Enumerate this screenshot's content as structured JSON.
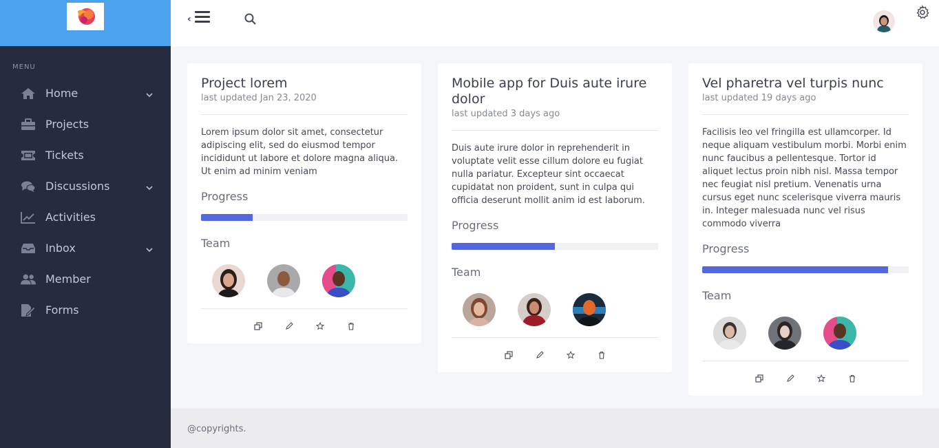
{
  "sidebar": {
    "menu_heading": "MENU",
    "items": [
      {
        "label": "Home",
        "icon": "home-icon",
        "has_submenu": true
      },
      {
        "label": "Projects",
        "icon": "briefcase-icon",
        "has_submenu": false
      },
      {
        "label": "Tickets",
        "icon": "ticket-icon",
        "has_submenu": false
      },
      {
        "label": "Discussions",
        "icon": "comments-icon",
        "has_submenu": true
      },
      {
        "label": "Activities",
        "icon": "chart-line-icon",
        "has_submenu": false
      },
      {
        "label": "Inbox",
        "icon": "inbox-icon",
        "has_submenu": true
      },
      {
        "label": "Member",
        "icon": "users-icon",
        "has_submenu": false
      },
      {
        "label": "Forms",
        "icon": "form-edit-icon",
        "has_submenu": false
      }
    ]
  },
  "header": {
    "toggle_icon": "menu-toggle-icon",
    "search_icon": "search-icon",
    "settings_icon": "gear-icon"
  },
  "cards": [
    {
      "title": "Project lorem",
      "updated": "last updated Jan 23, 2020",
      "body": "Lorem ipsum dolor sit amet, consectetur adipiscing elit, sed do eiusmod tempor incididunt ut labore et dolore magna aliqua. Ut enim ad minim veniam",
      "progress_label": "Progress",
      "progress_value": 25,
      "team_label": "Team"
    },
    {
      "title": "Mobile app for Duis aute irure dolor",
      "updated": "last updated 3 days ago",
      "body": "Duis aute irure dolor in reprehenderit in voluptate velit esse cillum dolore eu fugiat nulla pariatur. Excepteur sint occaecat cupidatat non proident, sunt in culpa qui officia deserunt mollit anim id est laborum.",
      "progress_label": "Progress",
      "progress_value": 50,
      "team_label": "Team"
    },
    {
      "title": "Vel pharetra vel turpis nunc",
      "updated": "last updated 19 days ago",
      "body": "Facilisis leo vel fringilla est ullamcorper. Id neque aliquam vestibulum morbi. Morbi enim nunc faucibus a pellentesque. Tortor id aliquet lectus proin nibh nisl. Massa tempor nec feugiat nisl pretium. Venenatis urna cursus eget nunc scelerisque viverra mauris in. Integer malesuada nunc vel risus commodo viverra",
      "progress_label": "Progress",
      "progress_value": 90,
      "team_label": "Team"
    }
  ],
  "footer": {
    "text": "@copyrights."
  },
  "colors": {
    "sidebar_bg": "#272b3f",
    "brand_bg": "#4ba3ee",
    "progress": "#5567dc",
    "page_bg": "#f4f5f8"
  }
}
